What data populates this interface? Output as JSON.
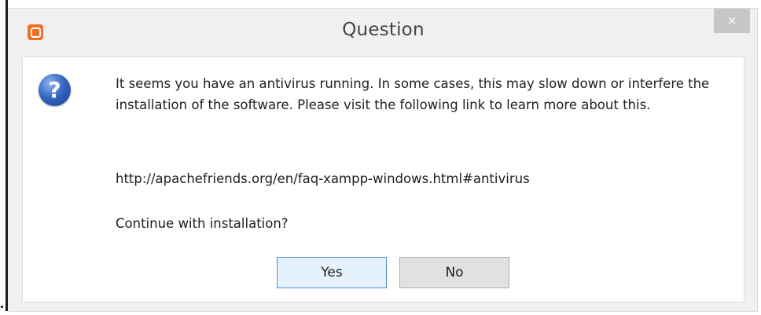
{
  "window": {
    "title": "Question",
    "close_label": "×",
    "app_icon": "xampp-logo-icon",
    "accent": "#f36e24"
  },
  "dialog": {
    "icon": "question-icon",
    "icon_glyph": "?",
    "message": "It seems you have an antivirus running. In some cases, this may slow down or interfere the installation of the software. Please visit the following link to learn more about this.",
    "link": "http://apachefriends.org/en/faq-xampp-windows.html#antivirus",
    "prompt": "Continue with installation?"
  },
  "buttons": {
    "yes_label": "Yes",
    "no_label": "No"
  }
}
